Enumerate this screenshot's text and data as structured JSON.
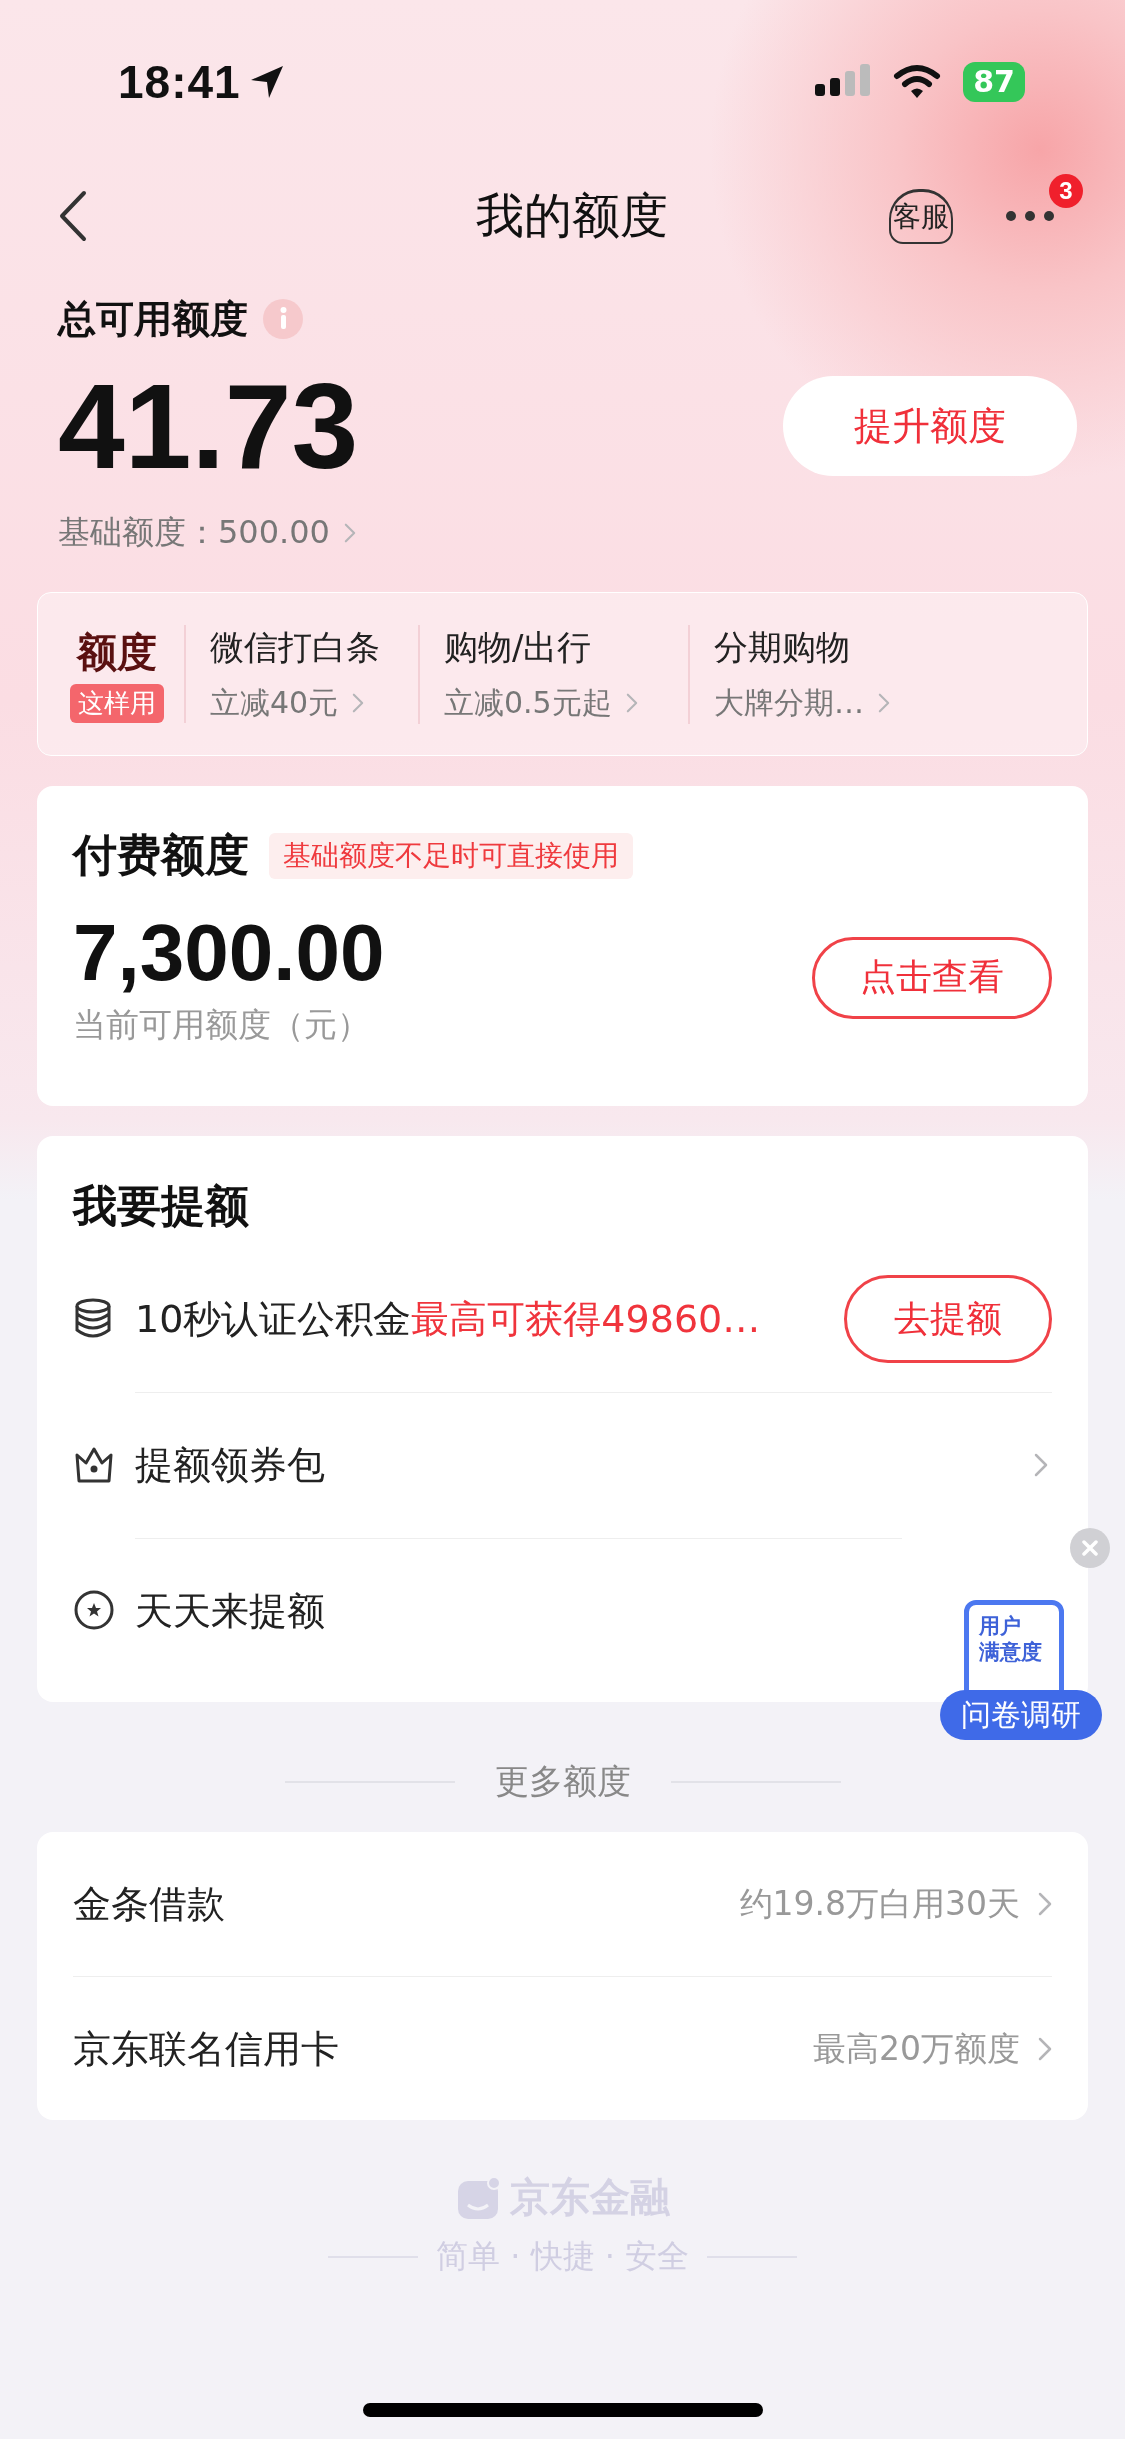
{
  "status_bar": {
    "time": "18:41",
    "battery": "87"
  },
  "nav": {
    "title": "我的额度",
    "service_label": "客服",
    "more_badge": "3"
  },
  "summary": {
    "label": "总可用额度",
    "amount": "41.73",
    "button": "提升额度",
    "base": "基础额度：500.00"
  },
  "usage_strip": {
    "title": "额度",
    "tag": "这样用",
    "items": [
      {
        "title": "微信打白条",
        "subtitle": "立减40元"
      },
      {
        "title": "购物/出行",
        "subtitle": "立减0.5元起"
      },
      {
        "title": "分期购物",
        "subtitle": "大牌分期…"
      }
    ]
  },
  "paid_card": {
    "title": "付费额度",
    "tag": "基础额度不足时可直接使用",
    "amount": "7,300.00",
    "caption": "当前可用额度（元）",
    "button": "点击查看"
  },
  "raise_card": {
    "title": "我要提额",
    "rows": [
      {
        "kind": "action",
        "text": "10秒认证公积金",
        "highlight": "最高可获得49860…",
        "button": "去提额"
      },
      {
        "kind": "link",
        "text": "提额领券包"
      },
      {
        "kind": "plain",
        "text": "天天来提额"
      }
    ]
  },
  "survey": {
    "lines": [
      "用户",
      "满意度"
    ],
    "button": "问卷调研"
  },
  "more_section": {
    "label": "更多额度",
    "rows": [
      {
        "title": "金条借款",
        "detail": "约19.8万白用30天"
      },
      {
        "title": "京东联名信用卡",
        "detail": "最高20万额度"
      }
    ]
  },
  "footer": {
    "brand": "京东金融",
    "tagline": "简单 · 快捷 · 安全"
  }
}
